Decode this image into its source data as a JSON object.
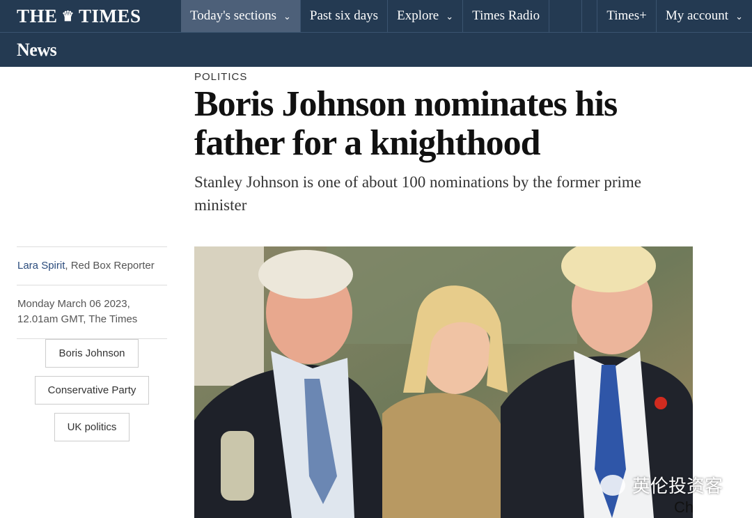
{
  "masthead": {
    "logo_left": "THE",
    "logo_right": "TIMES",
    "crest_icon": "crest-icon"
  },
  "nav": {
    "items": [
      {
        "label": "Today's sections",
        "dropdown": true,
        "active": true
      },
      {
        "label": "Past six days",
        "dropdown": false
      },
      {
        "label": "Explore",
        "dropdown": true
      },
      {
        "label": "Times Radio",
        "dropdown": false
      }
    ],
    "right": [
      {
        "label": "Times+",
        "dropdown": false
      },
      {
        "label": "My account",
        "dropdown": true
      }
    ]
  },
  "section": {
    "title": "News"
  },
  "article": {
    "kicker": "POLITICS",
    "headline": "Boris Johnson nominates his father for a knighthood",
    "standfirst": "Stanley Johnson is one of about 100 nominations by the former prime minister",
    "author": "Lara Spirit",
    "role": ", Red Box Reporter",
    "date_line1": "Monday March 06 2023,",
    "date_line2": "12.01am GMT, The Times",
    "tags": [
      "Boris Johnson",
      "Conservative Party",
      "UK politics"
    ]
  },
  "overlay": {
    "watermark": "英伦投资客",
    "corner": "Ch"
  },
  "colors": {
    "nav_bg": "#243a52",
    "nav_active": "#4d6079",
    "author_link": "#2a4b7c"
  }
}
